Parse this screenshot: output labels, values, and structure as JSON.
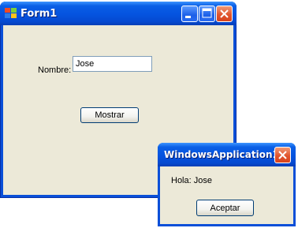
{
  "main_window": {
    "title": "Form1",
    "form": {
      "nombre_label": "Nombre:",
      "nombre_value": "Jose",
      "mostrar_label": "Mostrar"
    }
  },
  "message_box": {
    "title": "WindowsApplication1",
    "message": "Hola: Jose",
    "ok_label": "Aceptar"
  },
  "icons": {
    "app": "app-form-icon",
    "minimize": "minimize-icon",
    "maximize": "maximize-icon",
    "close": "close-icon"
  },
  "colors": {
    "titlebar": "#0553df",
    "client": "#ece9d8",
    "close_button": "#e0552e"
  }
}
